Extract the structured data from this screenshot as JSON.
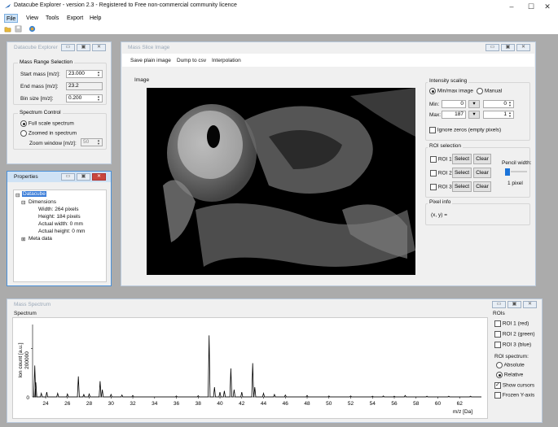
{
  "app": {
    "title": "Datacube Explorer - version 2.3 - Registered to Free non-commercial community licence",
    "window_controls": {
      "minimize": "–",
      "maximize": "☐",
      "close": "✕"
    }
  },
  "menu": [
    {
      "label": "File"
    },
    {
      "label": "View"
    },
    {
      "label": "Tools"
    },
    {
      "label": "Export"
    },
    {
      "label": "Help"
    }
  ],
  "toolbar": {
    "icons": [
      "open-folder-icon",
      "save-disk-icon",
      "globe-icon"
    ]
  },
  "datacube_explorer": {
    "title": "Datacube Explorer",
    "mass_range_group": "Mass Range Selection",
    "start_mass_label": "Start mass [m/z]:",
    "start_mass_value": "23.000",
    "end_mass_label": "End mass [m/z]:",
    "end_mass_value": "23.2",
    "bin_size_label": "Bin size [m/z]:",
    "bin_size_value": "0.200",
    "spectrum_control_group": "Spectrum Control",
    "full_scale_label": "Full scale spectrum",
    "zoomed_label": "Zoomed in spectrum",
    "zoom_window_label": "Zoom window [m/z]:",
    "zoom_window_value": "50"
  },
  "properties": {
    "title": "Properties",
    "tree": {
      "root": "Datacube",
      "dimensions": "Dimensions",
      "width": "Width: 264 pixels",
      "height": "Height: 184 pixels",
      "actual_width": "Actual width: 0 mm",
      "actual_height": "Actual height: 0 mm",
      "meta": "Meta data"
    }
  },
  "mass_slice": {
    "title": "Mass Slice Image",
    "menu": {
      "save": "Save plain image",
      "dump": "Dump to csv",
      "interp": "Interpolation"
    },
    "image_group": "Image",
    "intensity_group": "Intensity scaling",
    "minmax_label": "Min/max image",
    "manual_label": "Manual",
    "min_label": "Min:",
    "min_value": "0",
    "min_right": "0",
    "max_label": "Max:",
    "max_value": "187",
    "max_right": "1",
    "arrow": "▾",
    "ignore_zeros": "Ignore zeros (empty pixels)",
    "roi_group": "ROI selection",
    "roi": [
      {
        "label": "ROI 1",
        "select": "Select",
        "clear": "Clear"
      },
      {
        "label": "ROI 2",
        "select": "Select",
        "clear": "Clear"
      },
      {
        "label": "ROI 3",
        "select": "Select",
        "clear": "Clear"
      }
    ],
    "pencil_label": "Pencil width:",
    "pencil_value": "1 pixel",
    "pixel_info_group": "Pixel info",
    "pixel_info": "(x, y) ="
  },
  "mass_spectrum": {
    "title": "Mass Spectrum",
    "spectrum_group": "Spectrum",
    "ylabel": "Ion count [a.u.]",
    "y_tick_top": "200000",
    "y_tick_zero": "0",
    "xlabel": "m/z [Da]",
    "rois_group": "ROIs",
    "roi_items": [
      "ROI 1 (red)",
      "ROI 2 (green)",
      "ROI 3 (blue)"
    ],
    "roi_spectrum_label": "ROI spectrum:",
    "absolute_label": "Absolute",
    "relative_label": "Relative",
    "show_cursors": "Show cursors",
    "frozen_y": "Frozen Y-axis"
  },
  "chart_data": {
    "type": "line",
    "title": "",
    "xlabel": "m/z [Da]",
    "ylabel": "Ion count [a.u.]",
    "xlim": [
      22.8,
      64
    ],
    "ylim": [
      0,
      300000
    ],
    "x_ticks": [
      24,
      26,
      28,
      30,
      32,
      34,
      36,
      38,
      40,
      42,
      44,
      46,
      48,
      50,
      52,
      54,
      56,
      58,
      60,
      62
    ],
    "series": [
      {
        "values": [
          [
            23.0,
            130000
          ],
          [
            23.1,
            60000
          ],
          [
            23.6,
            15000
          ],
          [
            24.1,
            20000
          ],
          [
            25.1,
            15000
          ],
          [
            26.0,
            12000
          ],
          [
            27.0,
            85000
          ],
          [
            27.5,
            10000
          ],
          [
            28.0,
            12000
          ],
          [
            29.0,
            65000
          ],
          [
            29.2,
            30000
          ],
          [
            30.0,
            10000
          ],
          [
            31.0,
            8000
          ],
          [
            32.0,
            6000
          ],
          [
            36.0,
            4000
          ],
          [
            38.0,
            5000
          ],
          [
            39.0,
            255000
          ],
          [
            39.5,
            40000
          ],
          [
            40.0,
            20000
          ],
          [
            40.4,
            25000
          ],
          [
            41.0,
            118000
          ],
          [
            41.3,
            30000
          ],
          [
            42.0,
            20000
          ],
          [
            43.0,
            140000
          ],
          [
            43.2,
            40000
          ],
          [
            44.0,
            15000
          ],
          [
            45.0,
            10000
          ],
          [
            46.0,
            8000
          ],
          [
            48.0,
            6000
          ],
          [
            50.0,
            4000
          ],
          [
            52.0,
            4000
          ],
          [
            54.0,
            3000
          ],
          [
            55.0,
            4000
          ],
          [
            56.0,
            3000
          ],
          [
            57.0,
            6000
          ],
          [
            59.0,
            3000
          ],
          [
            61.0,
            3000
          ],
          [
            63.0,
            3000
          ]
        ]
      }
    ]
  }
}
